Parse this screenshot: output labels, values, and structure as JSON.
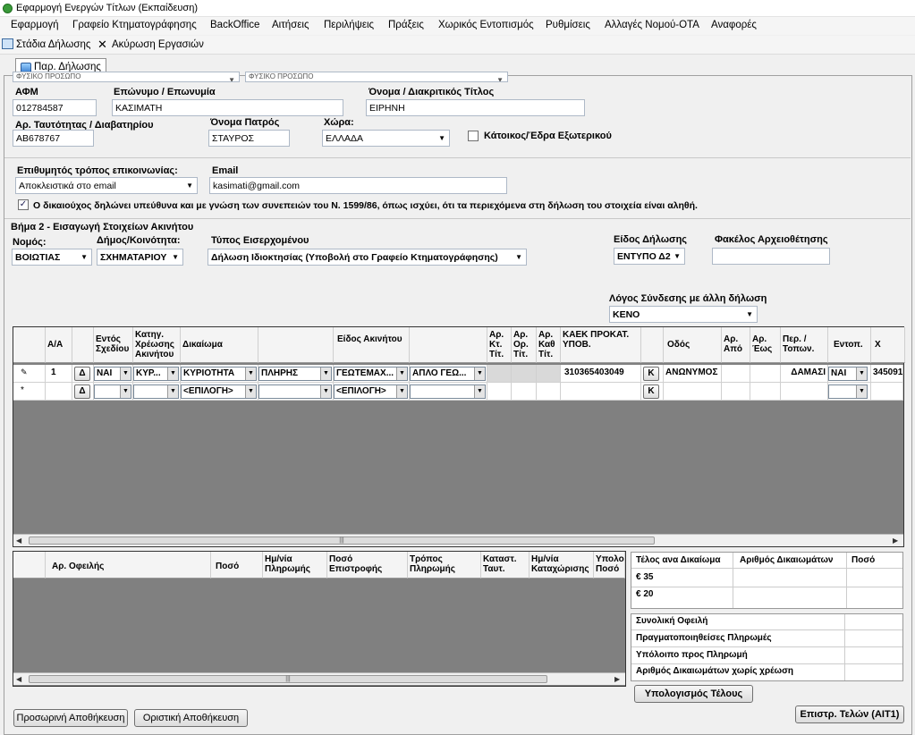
{
  "window": {
    "title": "Εφαρμογή Ενεργών Τίτλων (Εκπαίδευση)"
  },
  "menu": [
    "Εφαρμογή",
    "Γραφείο Κτηματογράφησης",
    "BackOffice",
    "Αιτήσεις",
    "Περιλήψεις",
    "Πράξεις",
    "Χωρικός Εντοπισμός",
    "Ρυθμίσεις",
    "Αλλαγές Νομού-ΟΤΑ",
    "Αναφορές"
  ],
  "toolbar": {
    "stages": "Στάδια Δήλωσης",
    "cancel": "Ακύρωση Εργασιών"
  },
  "tab": {
    "label": "Παρ. Δήλωσης"
  },
  "owner": {
    "top_combo1": "ΦΥΣΙΚΟ ΠΡΟΣΩΠΟ",
    "top_combo2": "ΦΥΣΙΚΟ ΠΡΟΣΩΠΟ",
    "afm_label": "ΑΦΜ",
    "afm": "012784587",
    "surname_label": "Επώνυμο / Επωνυμία",
    "surname": "ΚΑΣΙΜΑΤΗ",
    "name_label": "Όνομα / Διακριτικός Τίτλος",
    "name": "ΕΙΡΗΝΗ",
    "id_label": "Αρ. Ταυτότητας / Διαβατηρίου",
    "id": "ΑΒ678767",
    "father_label": "Όνομα Πατρός",
    "father": "ΣΤΑΥΡΟΣ",
    "country_label": "Χώρα:",
    "country": "ΕΛΛΑΔΑ",
    "abroad_label": "Κάτοικος/Έδρα Εξωτερικού",
    "contact_label": "Επιθυμητός τρόπος επικοινωνίας:",
    "contact": "Αποκλειστικά στο email",
    "email_label": "Email",
    "email": "kasimati@gmail.com",
    "declare_label": "Ο δικαιούχος δηλώνει υπεύθυνα και με γνώση των συνεπειών του Ν. 1599/86, όπως ισχύει, ότι τα περιεχόμενα στη δήλωση του στοιχεία είναι αληθή."
  },
  "step2": {
    "title": "Βήμα 2 - Εισαγωγή Στοιχείων Ακινήτου",
    "nomos_label": "Νομός:",
    "nomos": "ΒΟΙΩΤΙΑΣ",
    "dimos_label": "Δήμος/Κοινότητα:",
    "dimos": "ΣΧΗΜΑΤΑΡΙΟΥ",
    "type_label": "Τύπος Εισερχομένου",
    "type": "Δήλωση Ιδιοκτησίας  (Υποβολή στο Γραφείο Κτηματογράφησης)",
    "kind_label": "Είδος Δήλωσης",
    "kind": "ΕΝΤΥΠΟ Δ2",
    "folder_label": "Φακέλος Αρχειοθέτησης",
    "folder": "",
    "reason_label": "Λόγος Σύνδεσης με άλλη δήλωση",
    "reason": "ΚΕΝΟ"
  },
  "grid1": {
    "headers": [
      "Α/Α",
      "Εντός Σχεδίου",
      "Κατηγ. Χρέωσης Ακινήτου",
      "Δικαίωμα",
      "Είδος Ακινήτου",
      "Αρ. Κτ. Τίτ.",
      "Αρ. Ορ. Τίτ.",
      "Αρ. Καθ Τίτ.",
      "ΚΑΕΚ ΠΡΟΚΑΤ. ΥΠΟΒ.",
      "Οδός",
      "Αρ. Από",
      "Αρ. Έως",
      "Περ. / Τοπων.",
      "Εντοπ.",
      "X"
    ],
    "row1": {
      "aa": "1",
      "delta": "Δ",
      "entos": "ΝΑΙ",
      "katig": "ΚΥΡ...",
      "dikaioma": "ΚΥΡΙΟΤΗΤΑ",
      "plires": "ΠΛΗΡΗΣ",
      "eidos": "ΓΕΩΤΕΜΑΧ...",
      "aplo": "ΑΠΛΟ ΓΕΩ...",
      "kaek": "310365403049",
      "k": "Κ",
      "odos": "ΑΝΩΝΥΜΟΣ",
      "per": "ΔΑΜΑΣΙ",
      "entop": "ΝΑΙ",
      "x": "345091"
    },
    "row2": {
      "marker": "*",
      "delta": "Δ",
      "dikaioma": "<ΕΠΙΛΟΓΗ>",
      "eidos": "<ΕΠΙΛΟΓΗ>",
      "k": "Κ"
    },
    "row1_marker": "✎"
  },
  "grid2": {
    "headers": [
      "Αρ. Οφειλής",
      "Ποσό",
      "Ημ/νία Πληρωμής",
      "Ποσό Επιστροφής",
      "Τρόπος Πληρωμής",
      "Καταστ. Ταυτ.",
      "Ημ/νία Καταχώρισης",
      "Υπολοιπ. Ποσό"
    ]
  },
  "fees": {
    "h1": "Τέλος ανα Δικαίωμα",
    "h2": "Αριθμός Δικαιωμάτων",
    "h3": "Ποσό",
    "r1": "€ 35",
    "r2": "€ 20",
    "s1": "Συνολική Οφειλή",
    "s2": "Πραγματοποιηθείσες Πληρωμές",
    "s3": "Υπόλοιπο προς Πληρωμή",
    "s4": "Αριθμός Δικαιωμάτων χωρίς χρέωση"
  },
  "buttons": {
    "calc": "Υπολογισμός Τέλους",
    "temp_save": "Προσωρινή Αποθήκευση",
    "final_save": "Οριστική Αποθήκευση",
    "return": "Επιστρ. Τελών (ΑΙΤ1)"
  }
}
